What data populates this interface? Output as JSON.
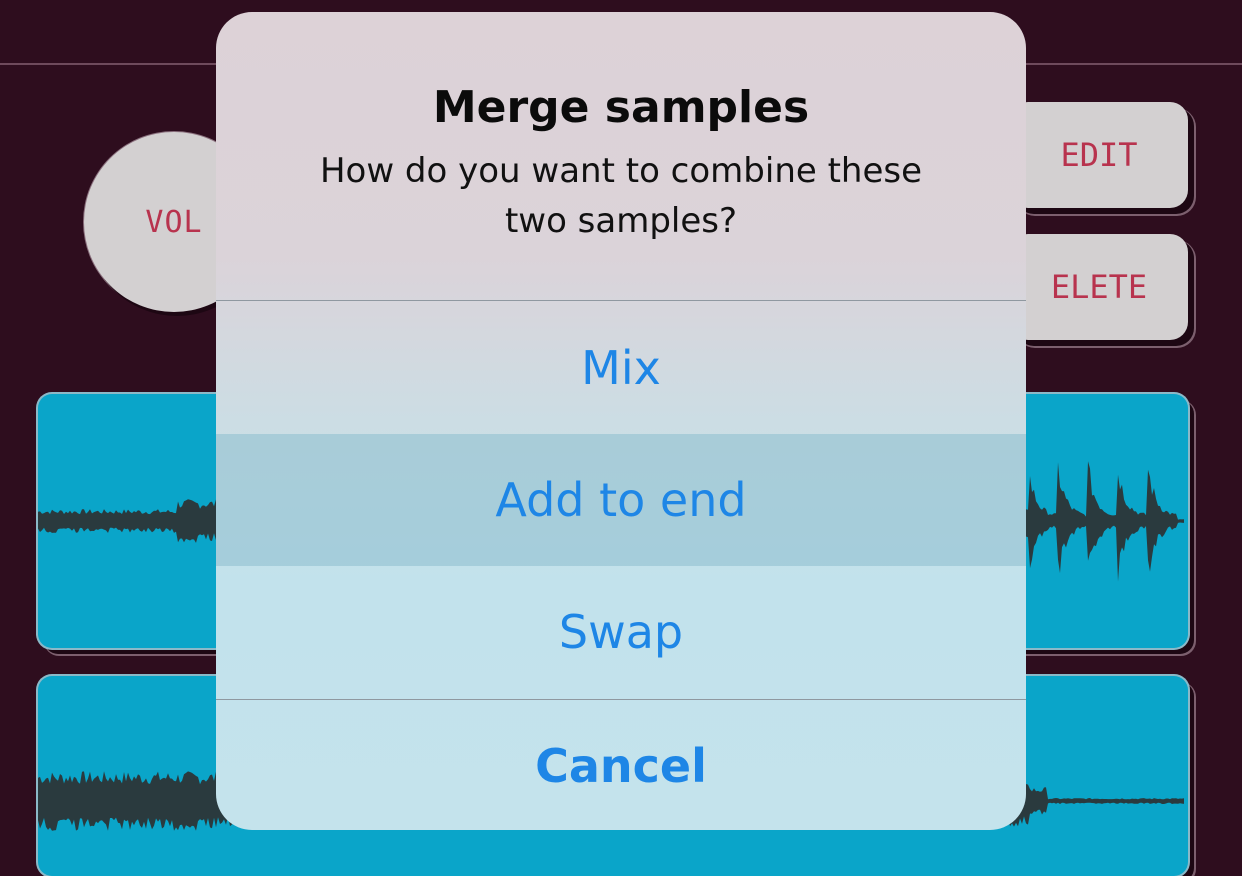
{
  "background_controls": {
    "vol_label": "VOL",
    "edit_label": "EDIT",
    "delete_label": "ELETE"
  },
  "colors": {
    "background": "#2e0d1e",
    "track": "#0aa5c9",
    "waveform": "#2a3a3e",
    "button_text": "#b8334e",
    "alert_action": "#1e86e6"
  },
  "alert": {
    "title": "Merge samples",
    "message": "How do you want to combine these two samples?",
    "actions": [
      {
        "label": "Mix"
      },
      {
        "label": "Add to end"
      },
      {
        "label": "Swap"
      },
      {
        "label": "Cancel"
      }
    ]
  }
}
